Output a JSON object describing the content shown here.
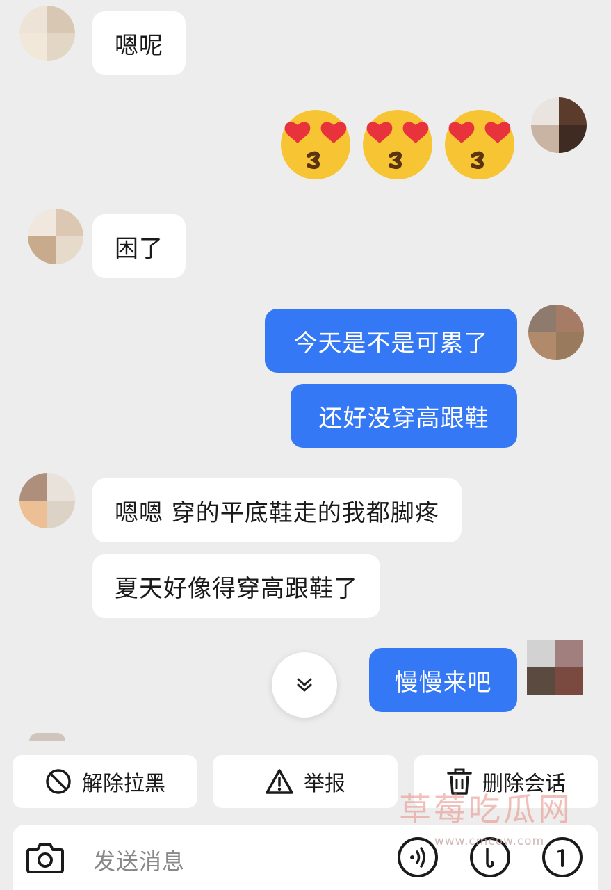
{
  "messages": {
    "m1": {
      "text": "嗯呢"
    },
    "m2": {
      "emoji": [
        "heart-eyes-kiss-emoji",
        "heart-eyes-kiss-emoji",
        "heart-eyes-kiss-emoji"
      ]
    },
    "m3": {
      "text": "困了"
    },
    "m4": {
      "text": "今天是不是可累了"
    },
    "m5": {
      "text": "还好没穿高跟鞋"
    },
    "m6": {
      "text": "嗯嗯 穿的平底鞋走的我都脚疼"
    },
    "m7": {
      "text": "夏天好像得穿高跟鞋了"
    },
    "m8": {
      "text": "慢慢来吧"
    }
  },
  "actions": {
    "unblock": "解除拉黑",
    "report": "举报",
    "delete_chat": "删除会话"
  },
  "input": {
    "placeholder": "发送消息"
  },
  "watermark": {
    "text": "草莓吃瓜网",
    "url": "www.cmcow.com"
  },
  "colors": {
    "background": "#ededed",
    "outgoing_bubble": "#3478f6",
    "incoming_bubble": "#ffffff"
  }
}
